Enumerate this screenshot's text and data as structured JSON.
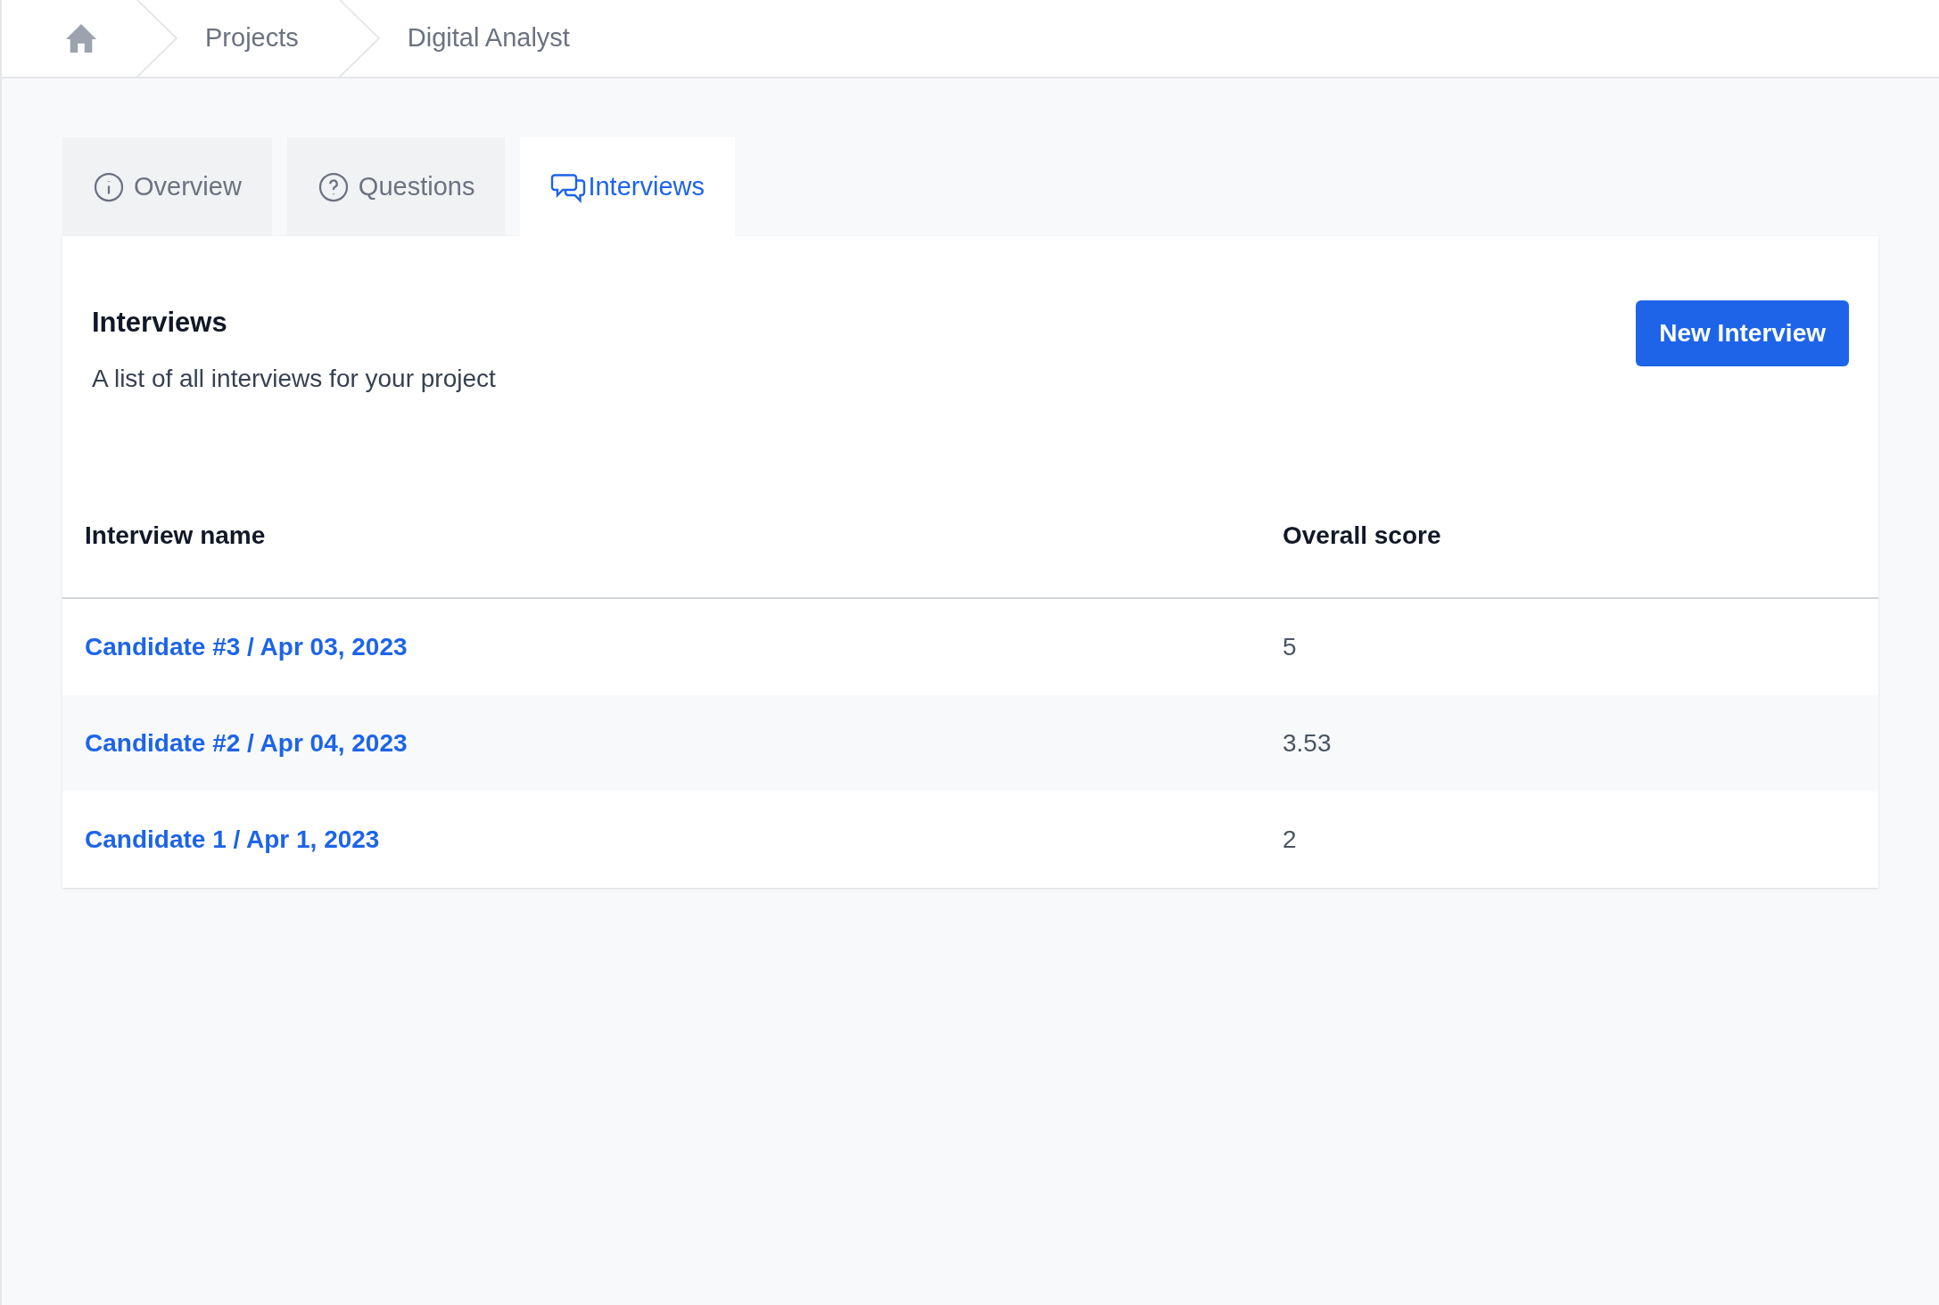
{
  "breadcrumb": [
    "Projects",
    "Digital Analyst"
  ],
  "tabs": [
    {
      "label": "Overview",
      "kind": "info",
      "selected": false
    },
    {
      "label": "Questions",
      "kind": "question",
      "selected": false
    },
    {
      "label": "Interviews",
      "kind": "chat",
      "selected": true
    }
  ],
  "panel": {
    "title": "Interviews",
    "subtitle": "A list of all interviews for your project",
    "button": "New Interview"
  },
  "table": {
    "columns": [
      "Interview name",
      "Overall score"
    ],
    "rows": [
      {
        "name": "Candidate #3 / Apr 03, 2023",
        "score": "5"
      },
      {
        "name": "Candidate #2 / Apr 04, 2023",
        "score": "3.53"
      },
      {
        "name": "Candidate 1 / Apr 1, 2023",
        "score": "2"
      }
    ]
  }
}
